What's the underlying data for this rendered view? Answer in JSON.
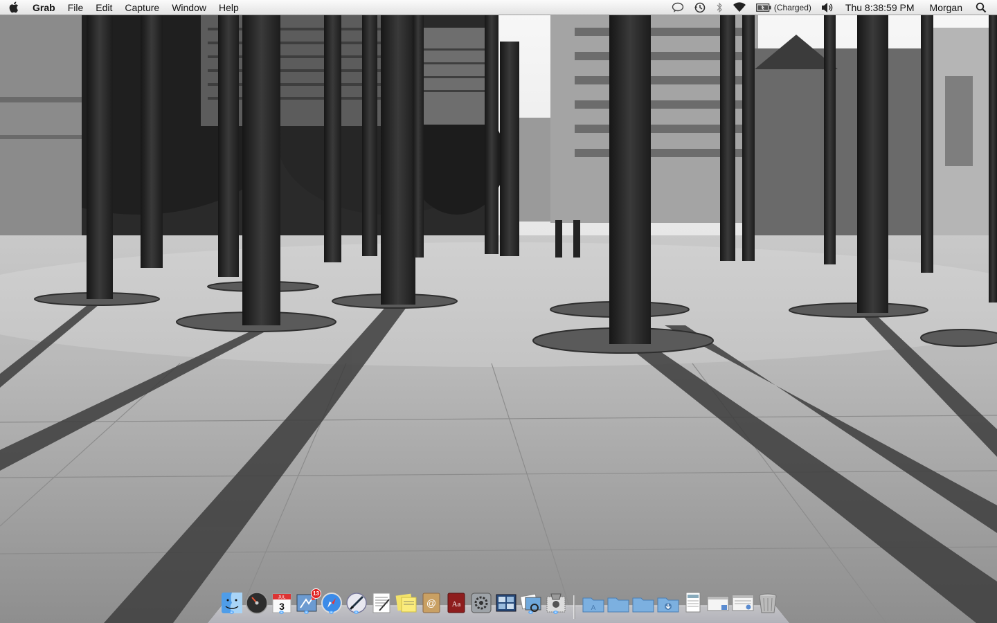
{
  "menubar": {
    "app_name": "Grab",
    "menus": [
      "File",
      "Edit",
      "Capture",
      "Window",
      "Help"
    ],
    "status": {
      "battery_text": "(Charged)",
      "clock": "Thu 8:38:59 PM",
      "user": "Morgan"
    },
    "status_icons": [
      "ichat-status-icon",
      "time-machine-icon",
      "bluetooth-icon",
      "wifi-icon",
      "battery-icon",
      "volume-icon",
      "spotlight-icon"
    ]
  },
  "dock": {
    "apps": [
      {
        "name": "finder-icon",
        "running": true
      },
      {
        "name": "dashboard-icon",
        "running": false
      },
      {
        "name": "ical-icon",
        "running": true,
        "text": "3",
        "label": "JUL"
      },
      {
        "name": "mail-icon",
        "running": true,
        "badge": "13"
      },
      {
        "name": "safari-icon",
        "running": true
      },
      {
        "name": "script-editor-icon",
        "running": true
      },
      {
        "name": "textedit-icon",
        "running": false
      },
      {
        "name": "stickies-icon",
        "running": false
      },
      {
        "name": "address-book-icon",
        "running": false
      },
      {
        "name": "dictionary-icon",
        "running": false,
        "text": "Aa"
      },
      {
        "name": "system-preferences-icon",
        "running": false
      },
      {
        "name": "expose-spaces-icon",
        "running": false
      },
      {
        "name": "preview-icon",
        "running": true
      },
      {
        "name": "grab-icon",
        "running": true
      }
    ],
    "stacks": [
      "applications-folder-icon",
      "documents-folder-icon",
      "folder-icon",
      "downloads-folder-icon",
      "document-stack-icon",
      "window-minimized-icon",
      "window-minimized-2-icon",
      "trash-icon"
    ]
  },
  "colors": {
    "menubar_top": "#fbfbfb",
    "menubar_bottom": "#e3e3e3",
    "wallpaper_sky": "#f2f2f2",
    "wallpaper_ground": "#a9a9a9",
    "accent_blue": "#3c9cff"
  }
}
